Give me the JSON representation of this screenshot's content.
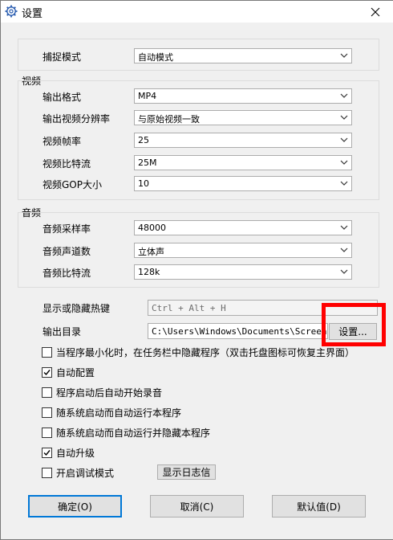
{
  "window": {
    "title": "设置",
    "icon": "gear-icon",
    "close_icon": "close-icon"
  },
  "capture": {
    "label": "捕捉模式",
    "value": "自动模式"
  },
  "video": {
    "group_label": "视频",
    "rows": [
      {
        "label": "输出格式",
        "value": "MP4"
      },
      {
        "label": "输出视频分辨率",
        "value": "与原始视频一致"
      },
      {
        "label": "视频帧率",
        "value": "25"
      },
      {
        "label": "视频比特流",
        "value": "25M"
      },
      {
        "label": "视频GOP大小",
        "value": "10"
      }
    ]
  },
  "audio": {
    "group_label": "音频",
    "rows": [
      {
        "label": "音频采样率",
        "value": "48000"
      },
      {
        "label": "音频声道数",
        "value": "立体声"
      },
      {
        "label": "音频比特流",
        "value": "128k"
      }
    ]
  },
  "hotkey": {
    "label": "显示或隐藏热键",
    "value": "Ctrl + Alt + H"
  },
  "output_dir": {
    "label": "输出目录",
    "value": "C:\\Users\\Windows\\Documents\\ScreenRec",
    "settings_button": "设置..."
  },
  "options": [
    {
      "label": "当程序最小化时，在任务栏中隐藏程序（双击托盘图标可恢复主界面）",
      "checked": false
    },
    {
      "label": "自动配置",
      "checked": true
    },
    {
      "label": "程序启动后自动开始录音",
      "checked": false
    },
    {
      "label": "随系统启动而自动运行本程序",
      "checked": false
    },
    {
      "label": "随系统启动而自动运行并隐藏本程序",
      "checked": false
    },
    {
      "label": "自动升级",
      "checked": true
    },
    {
      "label": "开启调试模式",
      "checked": false
    }
  ],
  "log_button": "显示日志信",
  "footer": {
    "ok": "确定(O)",
    "cancel": "取消(C)",
    "default": "默认值(D)"
  },
  "colors": {
    "highlight": "#ff0000",
    "ok_border": "#0078d7"
  }
}
